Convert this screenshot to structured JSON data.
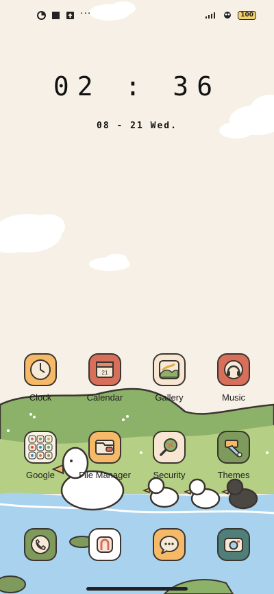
{
  "status_bar": {
    "notification_icons": [
      "notification-icon",
      "square-icon",
      "upload-icon"
    ],
    "overflow": "···",
    "system_icons": [
      "signal-icon",
      "wifi-icon",
      "battery-icon"
    ],
    "battery_level": "100"
  },
  "lockclock": {
    "time": "02 : 36",
    "date": "08 - 21  Wed."
  },
  "apps": {
    "row1": [
      {
        "name": "Clock",
        "icon": "clock-icon",
        "bg": "#f5b967"
      },
      {
        "name": "Calendar",
        "icon": "calendar-icon",
        "bg": "#d86f5a",
        "day": "21"
      },
      {
        "name": "Gallery",
        "icon": "gallery-icon",
        "bg": "#f6e6d2"
      },
      {
        "name": "Music",
        "icon": "headphones-icon",
        "bg": "#d86f5a"
      }
    ],
    "row2": [
      {
        "name": "Google",
        "icon": "google-folder-icon",
        "bg": "#f8f3e3"
      },
      {
        "name": "File Manager",
        "icon": "folder-icon",
        "bg": "#f5b967"
      },
      {
        "name": "Security",
        "icon": "magnifier-icon",
        "bg": "#f6e6d2"
      },
      {
        "name": "Themes",
        "icon": "paintbrush-icon",
        "bg": "#7e9a5c"
      }
    ],
    "dock": [
      {
        "name": "Phone",
        "icon": "phone-icon",
        "bg": "#7e9a5c"
      },
      {
        "name": "Messages",
        "icon": "message-app-icon",
        "bg": "#ffffff"
      },
      {
        "name": "Chat",
        "icon": "chat-bubble-icon",
        "bg": "#f5b967"
      },
      {
        "name": "Camera",
        "icon": "camera-icon",
        "bg": "#4f7f78"
      }
    ]
  },
  "colors": {
    "sky": "#f6f0e6",
    "hill": "#8cb168",
    "hill_light": "#b5cf85",
    "water": "#a9d2ee",
    "accent_orange": "#f5b967",
    "accent_red": "#d86f5a"
  }
}
